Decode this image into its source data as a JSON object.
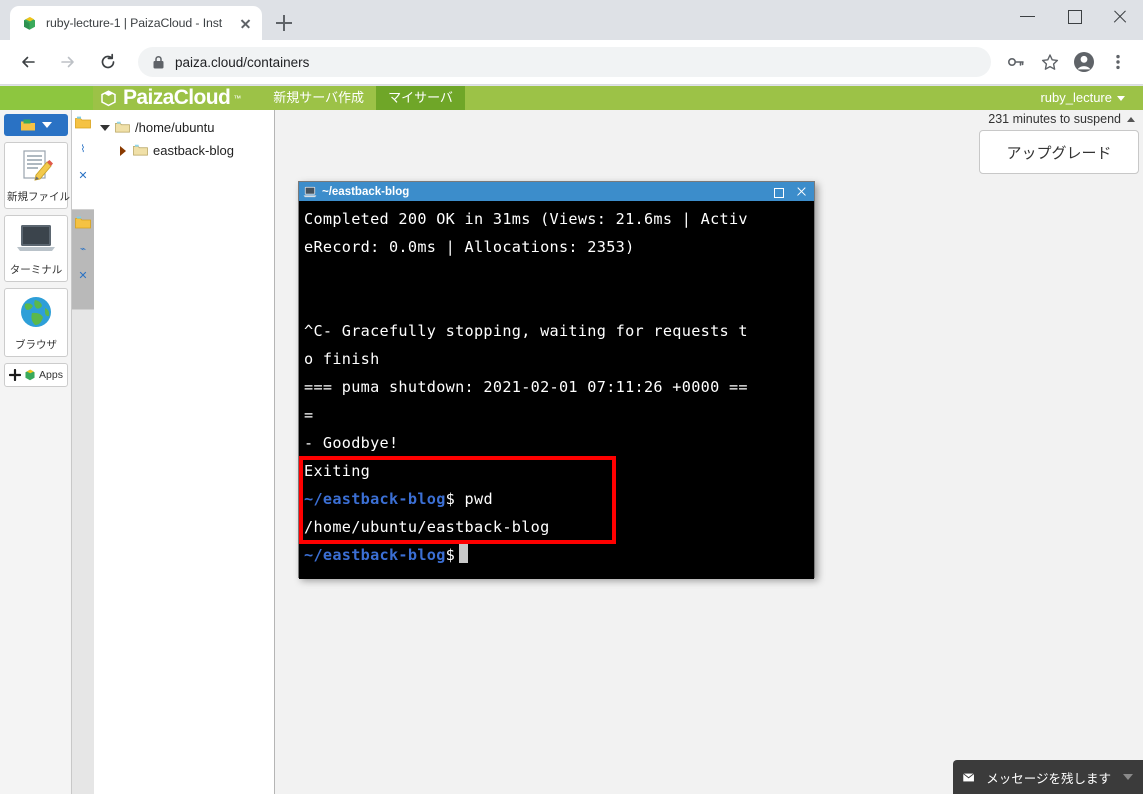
{
  "browser": {
    "tab": {
      "title": "ruby-lecture-1 | PaizaCloud - Inst",
      "favicon_name": "paizacloud-favicon"
    },
    "new_tab_label": "+",
    "window_controls": {
      "minimize": "minimize",
      "maximize": "maximize",
      "close": "close"
    },
    "toolbar": {
      "back": "back",
      "forward": "forward",
      "reload": "reload",
      "url": "paiza.cloud/containers",
      "lock": "secure",
      "key": "key-icon",
      "bookmark": "star-icon",
      "profile": "profile-icon",
      "menu": "three-dot-menu"
    }
  },
  "paizacloud": {
    "logo_text": "PaizaCloud",
    "logo_tm": "™",
    "nav": [
      {
        "label": "新規サーバ作成",
        "active": false
      },
      {
        "label": "マイサーバ",
        "active": true
      }
    ],
    "user": "ruby_lecture"
  },
  "rail": {
    "dropdown_label": "workspace-dropdown",
    "items": [
      {
        "label": "新規ファイル",
        "icon": "new-file-icon"
      },
      {
        "label": "ターミナル",
        "icon": "terminal-icon"
      },
      {
        "label": "ブラウザ",
        "icon": "browser-icon"
      }
    ],
    "apps_label": "Apps"
  },
  "vtabs": [
    {
      "name": "tab-folder-1",
      "active": true
    },
    {
      "name": "tab-folder-2",
      "active": false
    }
  ],
  "filetree": [
    {
      "label": "/home/ubuntu",
      "expanded": true,
      "indent": false
    },
    {
      "label": "eastback-blog",
      "expanded": false,
      "indent": true
    }
  ],
  "workspace": {
    "suspend_text": "231 minutes to suspend",
    "upgrade_label": "アップグレード"
  },
  "terminal": {
    "title": "~/eastback-blog",
    "lines": [
      {
        "type": "text",
        "text": "Completed 200 OK in 31ms (Views: 21.6ms | Activ"
      },
      {
        "type": "text",
        "text": "eRecord: 0.0ms | Allocations: 2353)"
      },
      {
        "type": "blank",
        "text": ""
      },
      {
        "type": "blank",
        "text": ""
      },
      {
        "type": "text",
        "text": "^C- Gracefully stopping, waiting for requests t"
      },
      {
        "type": "text",
        "text": "o finish"
      },
      {
        "type": "text",
        "text": "=== puma shutdown: 2021-02-01 07:11:26 +0000 =="
      },
      {
        "type": "text",
        "text": "="
      },
      {
        "type": "text",
        "text": "- Goodbye!"
      },
      {
        "type": "text",
        "text": "Exiting"
      },
      {
        "type": "prompt",
        "prompt": "~/eastback-blog",
        "dollar": "$",
        "command": " pwd"
      },
      {
        "type": "text",
        "text": "/home/ubuntu/eastback-blog"
      },
      {
        "type": "prompt-cursor",
        "prompt": "~/eastback-blog",
        "dollar": "$",
        "command": ""
      }
    ],
    "highlight_color": "#ff0000"
  },
  "message_widget": {
    "label": "メッセージを残します",
    "icon": "envelope-icon"
  }
}
